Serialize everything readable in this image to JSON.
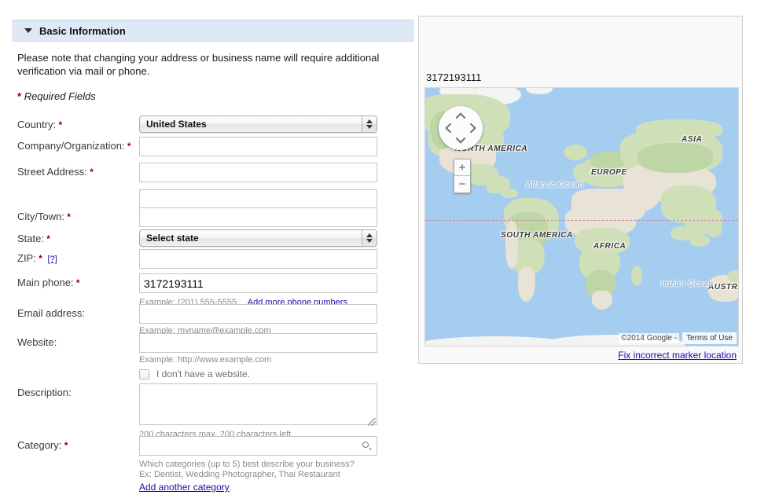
{
  "section": {
    "title": "Basic Information",
    "disclosure_icon": "triangle-down-icon",
    "note": "Please note that changing your address or business name will require additional verification via mail or phone.",
    "required_fields_label": "Required Fields",
    "required_marker": "*"
  },
  "form": {
    "fields": [
      {
        "key": "country",
        "label": "Country:",
        "required": true,
        "control": "select",
        "value": "United States"
      },
      {
        "key": "company",
        "label": "Company/Organization:",
        "required": true,
        "control": "text",
        "value": ""
      },
      {
        "key": "street1",
        "label": "Street Address:",
        "required": true,
        "control": "text",
        "value": ""
      },
      {
        "key": "street2",
        "label": "",
        "required": false,
        "control": "text",
        "value": ""
      },
      {
        "key": "city",
        "label": "City/Town:",
        "required": true,
        "control": "text",
        "value": ""
      },
      {
        "key": "state",
        "label": "State:",
        "required": true,
        "control": "select",
        "value": "Select state"
      },
      {
        "key": "zip",
        "label": "ZIP:",
        "required": true,
        "control": "text",
        "value": "",
        "help_link": "[?]"
      },
      {
        "key": "phone",
        "label": "Main phone:",
        "required": true,
        "control": "text",
        "value": "3172193111",
        "hint": "Example: (201) 555-5555",
        "hint_link": "Add more phone numbers"
      },
      {
        "key": "email",
        "label": "Email address:",
        "required": false,
        "control": "text",
        "value": "",
        "hint": "Example: myname@example.com"
      },
      {
        "key": "website",
        "label": "Website:",
        "required": false,
        "control": "text",
        "value": "",
        "hint": "Example: http://www.example.com"
      },
      {
        "key": "description",
        "label": "Description:",
        "required": false,
        "control": "textarea",
        "value": "",
        "hint": "200 characters max, 200 characters left."
      },
      {
        "key": "category",
        "label": "Category:",
        "required": true,
        "control": "search",
        "value": ""
      }
    ],
    "no_website_checkbox": {
      "label": "I don't have a website.",
      "checked": false
    },
    "category_help_line1": "Which categories (up to 5) best describe your business?",
    "category_help_line2": "Ex: Dentist, Wedding Photographer, Thai Restaurant",
    "category_add_link": "Add another category"
  },
  "map_panel": {
    "title": "3172193111",
    "pan_icon": "pan-control-icon",
    "zoom_in_label": "+",
    "zoom_out_label": "−",
    "copyright": "©2014 Google -",
    "terms_label": "Terms of Use",
    "fix_marker_link": "Fix incorrect marker location",
    "labels": [
      {
        "text": "NORTH AMERICA",
        "kind": "continent"
      },
      {
        "text": "SOUTH AMERICA",
        "kind": "continent"
      },
      {
        "text": "EUROPE",
        "kind": "continent"
      },
      {
        "text": "AFRICA",
        "kind": "continent"
      },
      {
        "text": "ASIA",
        "kind": "continent"
      },
      {
        "text": "AUSTRALIA",
        "kind": "continent"
      },
      {
        "text": "Atlantic Ocean",
        "kind": "ocean"
      },
      {
        "text": "Indian Ocean",
        "kind": "ocean"
      }
    ]
  },
  "colors": {
    "section_header_bg": "#dfe8f6",
    "link": "#1a0dab",
    "required_star": "#8b0000",
    "hint_text": "#8a8a8a",
    "map_water": "#a5cdf0",
    "map_land": "#e8e3d4",
    "map_green": "#cfe0b9"
  }
}
